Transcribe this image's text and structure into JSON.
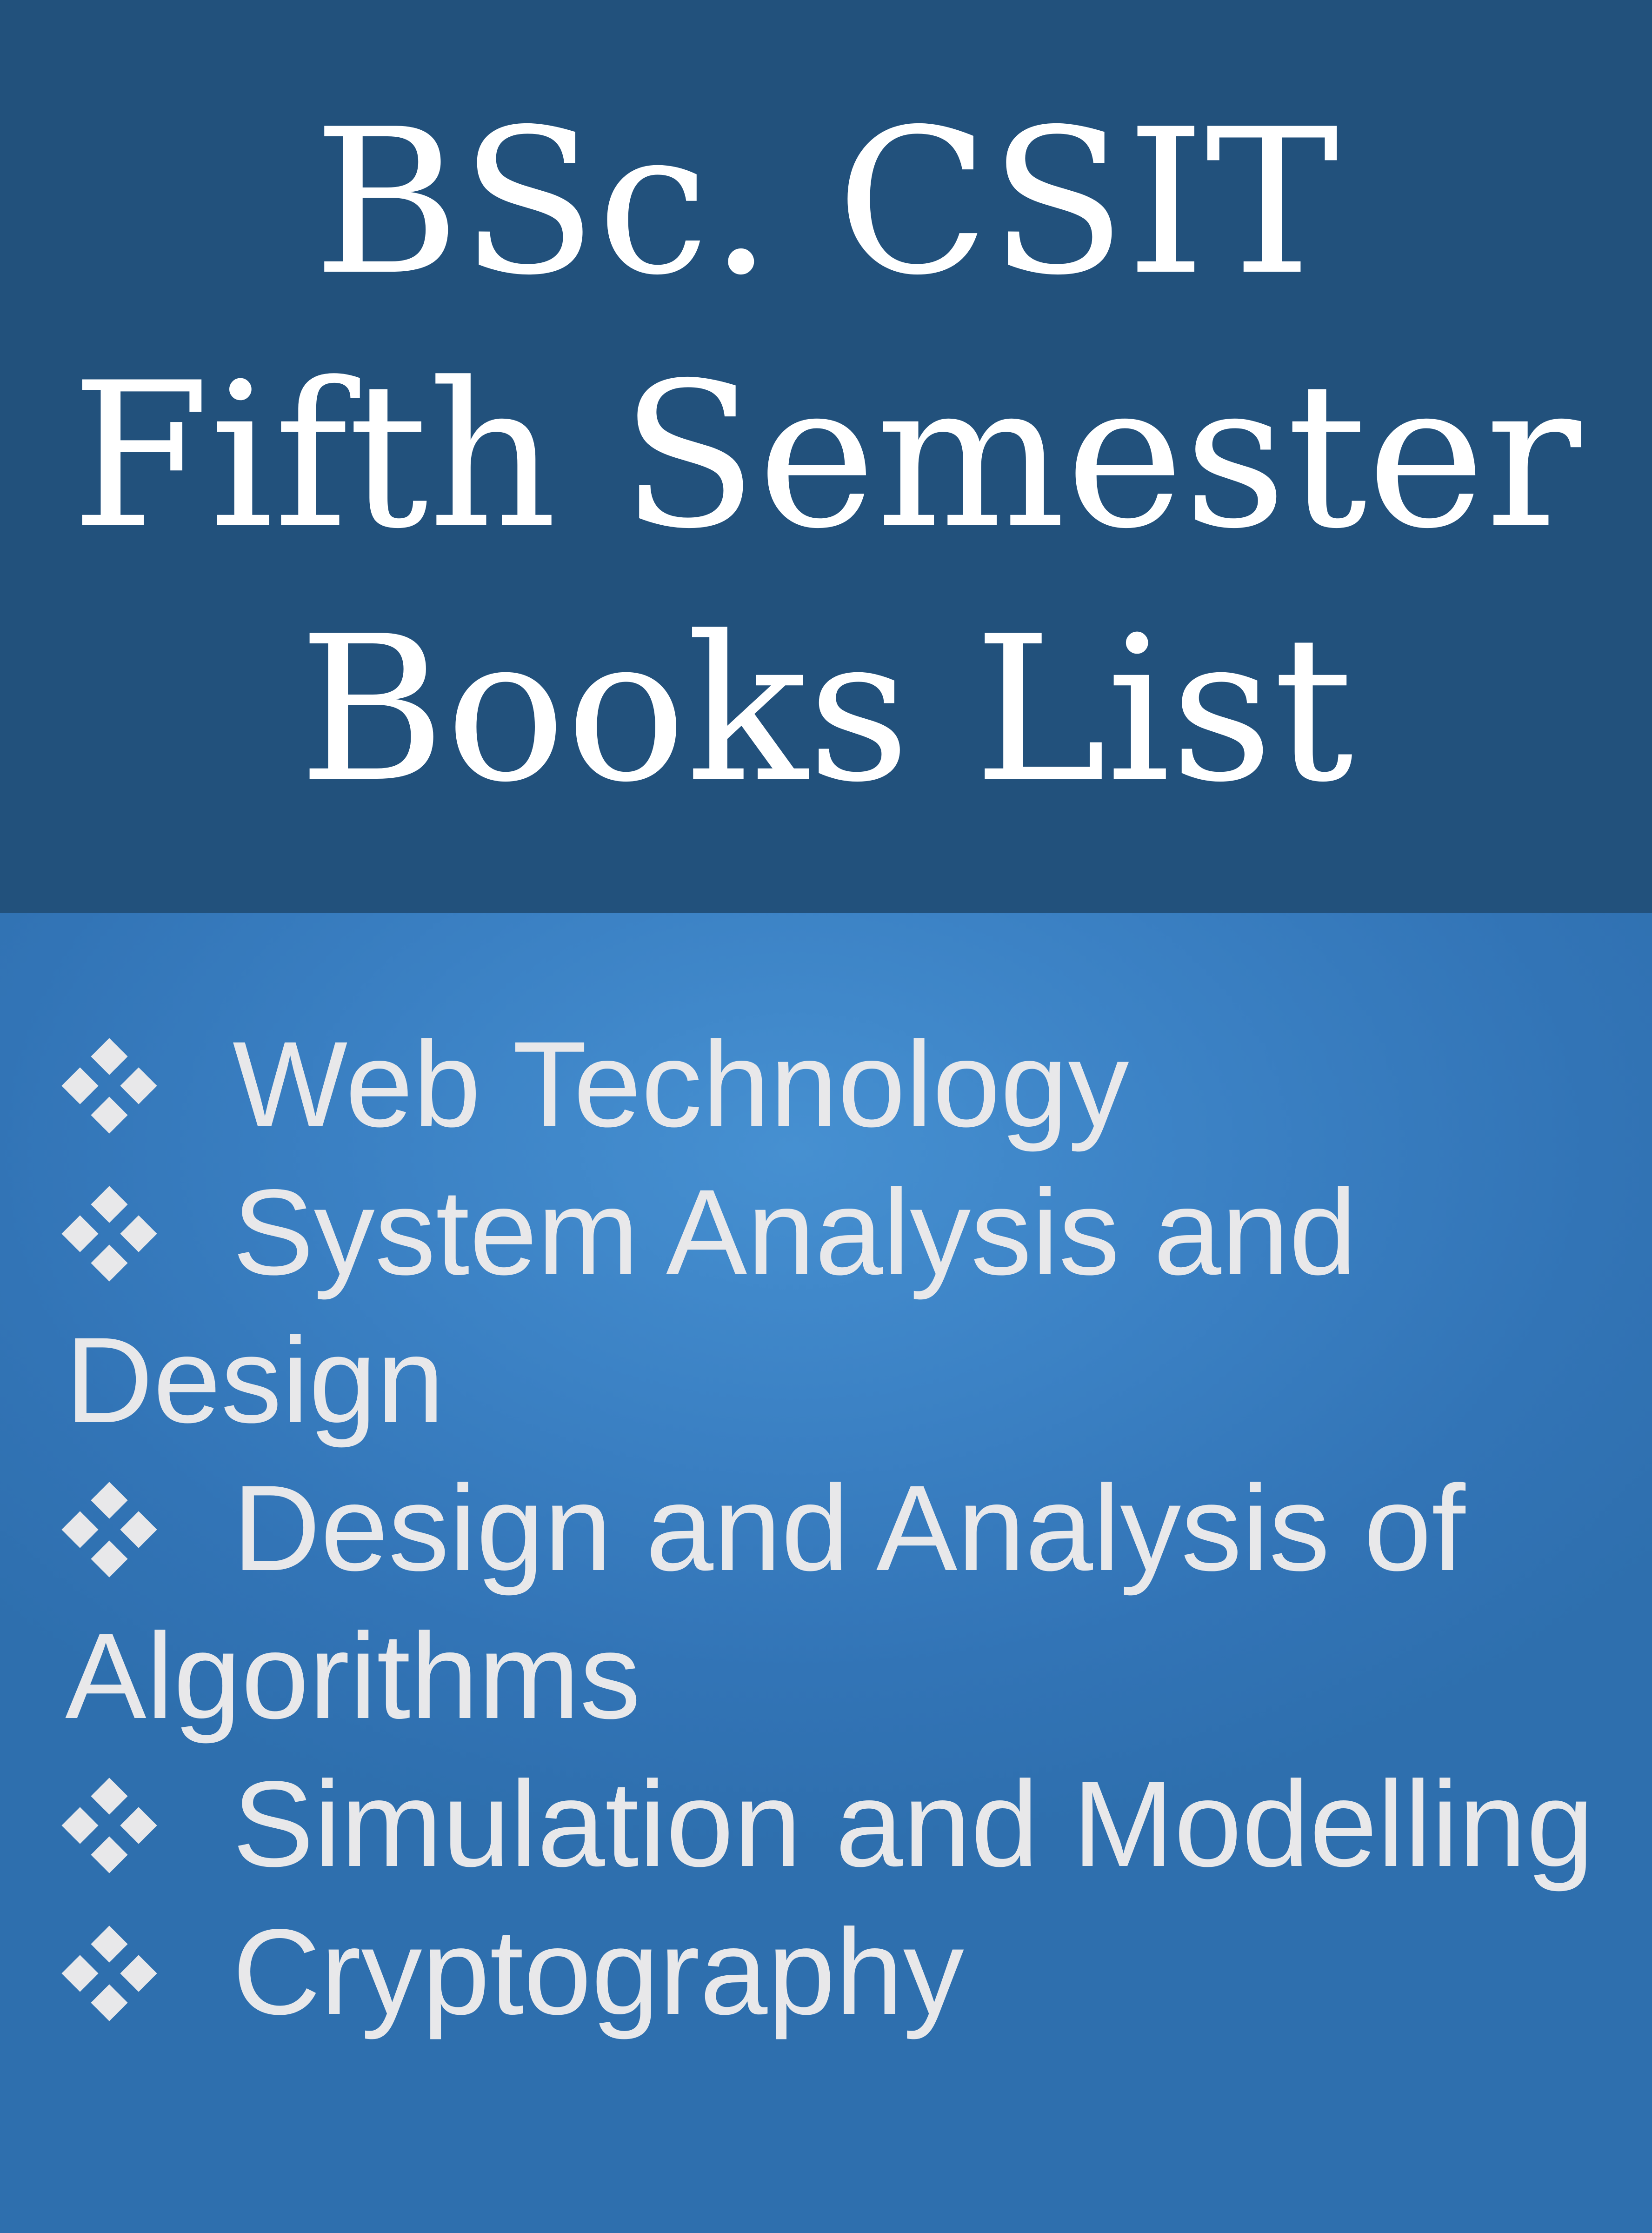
{
  "header": {
    "title_lines": [
      "BSc. CSIT",
      "Fifth Semester",
      "Books List"
    ]
  },
  "subjects": [
    {
      "line1": "Web Technology",
      "line2": ""
    },
    {
      "line1": "System Analysis and",
      "line2": "Design"
    },
    {
      "line1": "Design and Analysis of",
      "line2": "Algorithms"
    },
    {
      "line1": "Simulation and Modelling",
      "line2": ""
    },
    {
      "line1": "Cryptography",
      "line2": ""
    }
  ],
  "icons": {
    "bullet": "four-diamond-bullet-icon"
  },
  "colors": {
    "header_bg": "#22517c",
    "body_bg": "#3b81c4",
    "title_text": "#ffffff",
    "list_text": "#e8e8ea"
  }
}
